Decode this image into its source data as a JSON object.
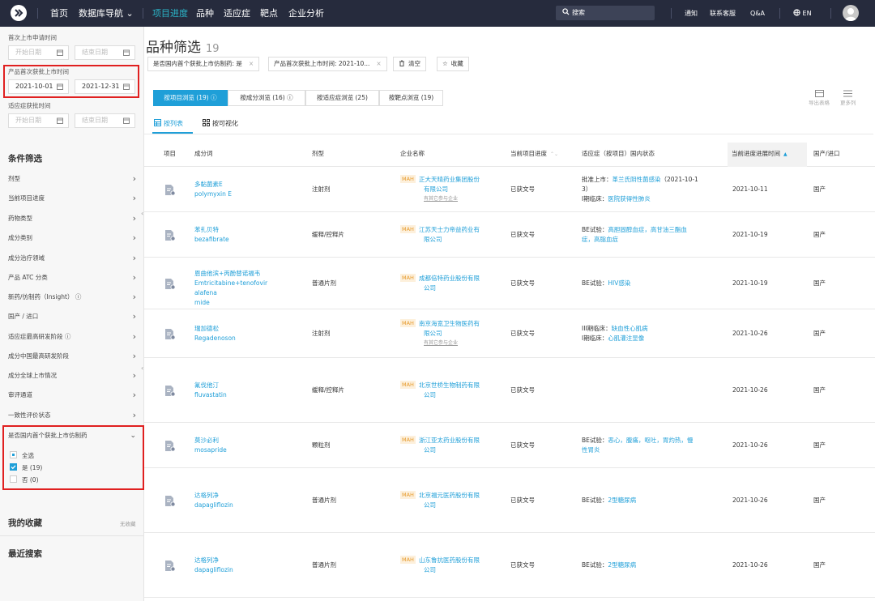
{
  "topbar": {
    "nav": [
      "首页",
      "数据库导航 ⌄",
      "项目进度",
      "品种",
      "适应症",
      "靶点",
      "企业分析"
    ],
    "search_placeholder": "搜索",
    "right": [
      "通知",
      "联系客服",
      "Q&A",
      "EN"
    ]
  },
  "sidebar": {
    "date_filters": [
      {
        "label": "首次上市申请时间",
        "start": "开始日期",
        "end": "结束日期",
        "filled": false
      },
      {
        "label": "产品首次获批上市时间",
        "start": "2021-10-01",
        "end": "2021-12-31",
        "filled": true
      },
      {
        "label": "适应症获批时间",
        "start": "开始日期",
        "end": "结束日期",
        "filled": false
      }
    ],
    "section_filter": "条件筛选",
    "filters": [
      "剂型",
      "当前项目进度",
      "药物类型",
      "成分类别",
      "成分治疗领域",
      "产品 ATC 分类",
      "新药/仿制药（Insight） ⓘ",
      "国产 / 进口",
      "适应症最高研发阶段 ⓘ",
      "成分中国最高研发阶段",
      "成分全球上市情况",
      "审评通道",
      "一致性评价状态"
    ],
    "expanded_filter": "是否国内首个获批上市仿制药",
    "options": [
      {
        "label": "全选",
        "state": "partial"
      },
      {
        "label": "是 (19)",
        "state": "checked"
      },
      {
        "label": "否 (0)",
        "state": "unchecked"
      }
    ],
    "favorites_title": "我的收藏",
    "favorites_empty": "无收藏",
    "recent_title": "最近搜索"
  },
  "main": {
    "title": "品种筛选",
    "count": "19",
    "tags": [
      "是否国内首个获批上市仿制药: 是",
      "产品首次获批上市时间: 2021-10..."
    ],
    "clear_label": "清空",
    "collect_label": "收藏",
    "tabs": [
      "按项目浏览 (19) ⓘ",
      "按成分浏览 (16) ⓘ",
      "按适应症浏览 (25)",
      "按靶点浏览 (19)"
    ],
    "subtabs": [
      "按列表",
      "按可视化"
    ],
    "tools": [
      "导出表格",
      "更多列"
    ],
    "headers": [
      "项目",
      "成分词",
      "剂型",
      "企业名称",
      "当前项目进度",
      "适应症（按项目）国内状态",
      "当前进度进展时间",
      "国产/进口"
    ],
    "sort_icon_text": "⌃⌄",
    "rows": [
      {
        "name_cn": "多黏菌素E",
        "name_en": [
          "polymyxin E"
        ],
        "form": "注射剂",
        "mah": "MAH",
        "company": [
          "正大天晴药业集团股份",
          "有限公司"
        ],
        "sub": "有其它参与企业",
        "progress": "已获文号",
        "indication": [
          [
            "批准上市：",
            "革兰氏阴性菌感染",
            "（2021-10-1"
          ],
          [
            "3）",
            "",
            ""
          ],
          [
            "I期临床：",
            "医院获得性肺炎",
            ""
          ]
        ],
        "date": "2021-10-11",
        "origin": "国产"
      },
      {
        "name_cn": "苯扎贝特",
        "name_en": [
          "bezafibrate"
        ],
        "form": "缓释/控释片",
        "mah": "MAH",
        "company": [
          "江苏天士力帝益药业有",
          "限公司"
        ],
        "sub": "",
        "progress": "已获文号",
        "indication": [
          [
            "BE试验：",
            "高胆固醇血症，高甘油三酯血",
            ""
          ],
          [
            "",
            "症，高脂血症",
            ""
          ]
        ],
        "date": "2021-10-19",
        "origin": "国产"
      },
      {
        "name_cn": "恩曲他滨+丙酚替诺福韦",
        "name_en": [
          "Emtricitabine+tenofovir alafena",
          "mide"
        ],
        "form": "普通片剂",
        "mah": "MAH",
        "company": [
          "成都倍特药业股份有限",
          "公司"
        ],
        "sub": "",
        "progress": "已获文号",
        "indication": [
          [
            "BE试验：",
            "HIV感染",
            ""
          ]
        ],
        "date": "2021-10-19",
        "origin": "国产"
      },
      {
        "name_cn": "瑞加德松",
        "name_en": [
          "Regadenoson"
        ],
        "form": "注射剂",
        "mah": "MAH",
        "company": [
          "南京海宽卫生物医药有",
          "限公司"
        ],
        "sub": "有其它参与企业",
        "progress": "已获文号",
        "indication": [
          [
            "III期临床：",
            "缺血性心肌病",
            ""
          ],
          [
            "I期临床：",
            "心肌灌注显像",
            ""
          ]
        ],
        "date": "2021-10-26",
        "origin": "国产"
      },
      {
        "name_cn": "氟伐他汀",
        "name_en": [
          "fluvastatin"
        ],
        "form": "缓释/控释片",
        "mah": "MAH",
        "company": [
          "北京世桥生物制药有限",
          "公司"
        ],
        "sub": "",
        "progress": "已获文号",
        "indication": [],
        "date": "2021-10-26",
        "origin": "国产"
      },
      {
        "name_cn": "莫沙必利",
        "name_en": [
          "mosapride"
        ],
        "form": "颗粒剂",
        "mah": "MAH",
        "company": [
          "浙江亚太药业股份有限",
          "公司"
        ],
        "sub": "",
        "progress": "已获文号",
        "indication": [
          [
            "BE试验：",
            "恶心，腹痛，呕吐，胃灼热，慢",
            ""
          ],
          [
            "",
            "性胃炎",
            ""
          ]
        ],
        "date": "2021-10-26",
        "origin": "国产"
      },
      {
        "name_cn": "达格列净",
        "name_en": [
          "dapagliflozin"
        ],
        "form": "普通片剂",
        "mah": "MAH",
        "company": [
          "北京福元医药股份有限",
          "公司"
        ],
        "sub": "",
        "progress": "已获文号",
        "indication": [
          [
            "BE试验：",
            "2型糖尿病",
            ""
          ]
        ],
        "date": "2021-10-26",
        "origin": "国产"
      },
      {
        "name_cn": "达格列净",
        "name_en": [
          "dapagliflozin"
        ],
        "form": "普通片剂",
        "mah": "MAH",
        "company": [
          "山东鲁抗医药股份有限",
          "公司"
        ],
        "sub": "",
        "progress": "已获文号",
        "indication": [
          [
            "BE试验：",
            "2型糖尿病",
            ""
          ]
        ],
        "date": "2021-10-26",
        "origin": "国产"
      }
    ]
  },
  "colors": {
    "topbar": "#262b3d",
    "accent": "#1f9fd8",
    "nav_active": "#2bb5c8",
    "highlight": "#e02020",
    "mah_bg": "#fdf0dc",
    "mah_text": "#e69a2b"
  }
}
